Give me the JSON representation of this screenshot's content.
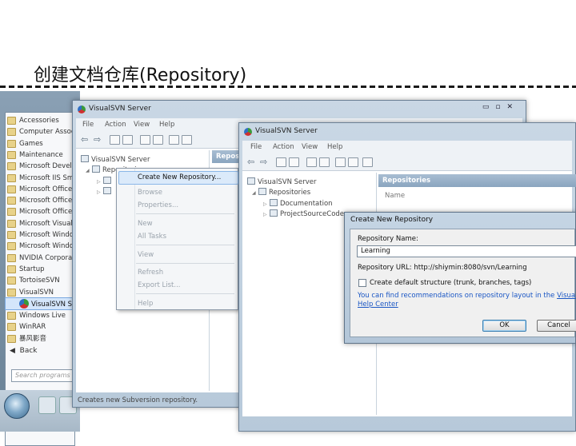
{
  "slide": {
    "title": "创建文档仓库(Repository)"
  },
  "start_menu": {
    "items": [
      "Accessories",
      "Computer Assoc",
      "Games",
      "Maintenance",
      "Microsoft Develo",
      "Microsoft IIS Sma",
      "Microsoft Office",
      "Microsoft Office",
      "Microsoft Office",
      "Microsoft Visual",
      "Microsoft Windo",
      "Microsoft Windo",
      "NVIDIA Corporat",
      "Startup",
      "TortoiseSVN",
      "VisualSVN"
    ],
    "selected": "VisualSVN Se",
    "after": [
      "Windows Live",
      "WinRAR",
      "暴风影音"
    ],
    "back": "Back",
    "search_placeholder": "Search programs"
  },
  "window1": {
    "title": "VisualSVN Server",
    "menu": [
      "File",
      "Action",
      "View",
      "Help"
    ],
    "tree": {
      "root": "VisualSVN Server",
      "repos": "Repositories"
    },
    "pane_header": "Repos",
    "status": "Creates new Subversion repository."
  },
  "context_menu": {
    "items": [
      "Create New Repository...",
      "Browse",
      "Properties...",
      "New",
      "All Tasks",
      "View",
      "Refresh",
      "Export List...",
      "Help"
    ]
  },
  "window2": {
    "title": "VisualSVN Server",
    "menu": [
      "File",
      "Action",
      "View",
      "Help"
    ],
    "tree": {
      "root": "VisualSVN Server",
      "repos": "Repositories",
      "child1": "Documentation",
      "child2": "ProjectSourceCode"
    },
    "pane_header": "Repositories",
    "column": "Name"
  },
  "dialog": {
    "title": "Create New Repository",
    "name_label": "Repository Name:",
    "name_value": "Learning",
    "url_label": "Repository URL:",
    "url_value": "http://shiymin:8080/svn/Learning",
    "checkbox_label": "Create default structure (trunk, branches, tags)",
    "hint_text": "You can find recommendations on repository layout in the",
    "hint_link1": "VisualSVN",
    "hint_link2": "Help Center",
    "ok_label": "OK",
    "cancel_label": "Cancel"
  }
}
